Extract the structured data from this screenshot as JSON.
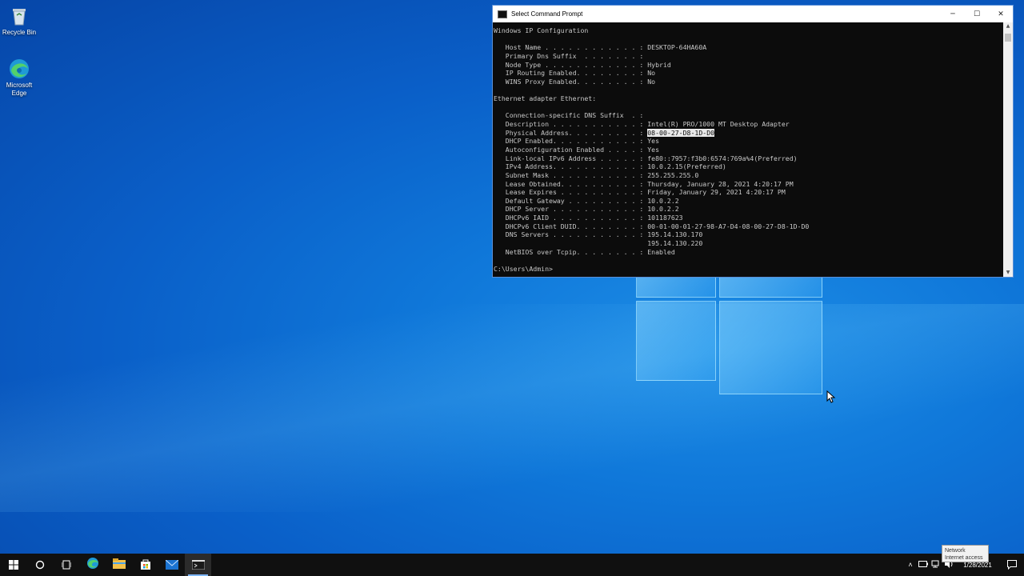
{
  "desktop": {
    "icons": [
      {
        "label": "Recycle Bin",
        "icon": "recycle-bin-icon"
      },
      {
        "label": "Microsoft Edge",
        "icon": "edge-icon"
      }
    ]
  },
  "window": {
    "title": "Select Command Prompt",
    "controls": {
      "minimize": "─",
      "maximize": "☐",
      "close": "✕"
    }
  },
  "console": {
    "lines": [
      "Windows IP Configuration",
      "",
      "   Host Name . . . . . . . . . . . . : DESKTOP-64HA60A",
      "   Primary Dns Suffix  . . . . . . . :",
      "   Node Type . . . . . . . . . . . . : Hybrid",
      "   IP Routing Enabled. . . . . . . . : No",
      "   WINS Proxy Enabled. . . . . . . . : No",
      "",
      "Ethernet adapter Ethernet:",
      "",
      "   Connection-specific DNS Suffix  . :",
      "   Description . . . . . . . . . . . : Intel(R) PRO/1000 MT Desktop Adapter",
      "   Physical Address. . . . . . . . . : ",
      "   DHCP Enabled. . . . . . . . . . . : Yes",
      "   Autoconfiguration Enabled . . . . : Yes",
      "   Link-local IPv6 Address . . . . . : fe80::7957:f3b0:6574:769a%4(Preferred)",
      "   IPv4 Address. . . . . . . . . . . : 10.0.2.15(Preferred)",
      "   Subnet Mask . . . . . . . . . . . : 255.255.255.0",
      "   Lease Obtained. . . . . . . . . . : Thursday, January 28, 2021 4:20:17 PM",
      "   Lease Expires . . . . . . . . . . : Friday, January 29, 2021 4:20:17 PM",
      "   Default Gateway . . . . . . . . . : 10.0.2.2",
      "   DHCP Server . . . . . . . . . . . : 10.0.2.2",
      "   DHCPv6 IAID . . . . . . . . . . . : 101187623",
      "   DHCPv6 Client DUID. . . . . . . . : 00-01-00-01-27-98-A7-D4-08-00-27-D8-1D-D0",
      "   DNS Servers . . . . . . . . . . . : 195.14.130.170",
      "                                       195.14.130.220",
      "   NetBIOS over Tcpip. . . . . . . . : Enabled",
      "",
      "C:\\Users\\Admin>"
    ],
    "selected_value": "08-00-27-D8-1D-D0"
  },
  "taskbar": {
    "items": [
      {
        "name": "start",
        "icon": "windows-start-icon"
      },
      {
        "name": "search",
        "icon": "search-circle-icon"
      },
      {
        "name": "task-view",
        "icon": "task-view-icon"
      },
      {
        "name": "edge",
        "icon": "edge-icon"
      },
      {
        "name": "file-explorer",
        "icon": "folder-icon"
      },
      {
        "name": "store",
        "icon": "store-bag-icon"
      },
      {
        "name": "mail",
        "icon": "mail-icon"
      },
      {
        "name": "command-prompt",
        "icon": "terminal-icon",
        "active": true
      }
    ],
    "tray": {
      "date": "1/28/2021",
      "icons": [
        "chevron-up-icon",
        "battery-icon",
        "network-icon",
        "volume-icon"
      ],
      "notification_icon": "action-center-icon"
    },
    "tooltip": {
      "line1": "Network",
      "line2": "Internet access"
    }
  }
}
